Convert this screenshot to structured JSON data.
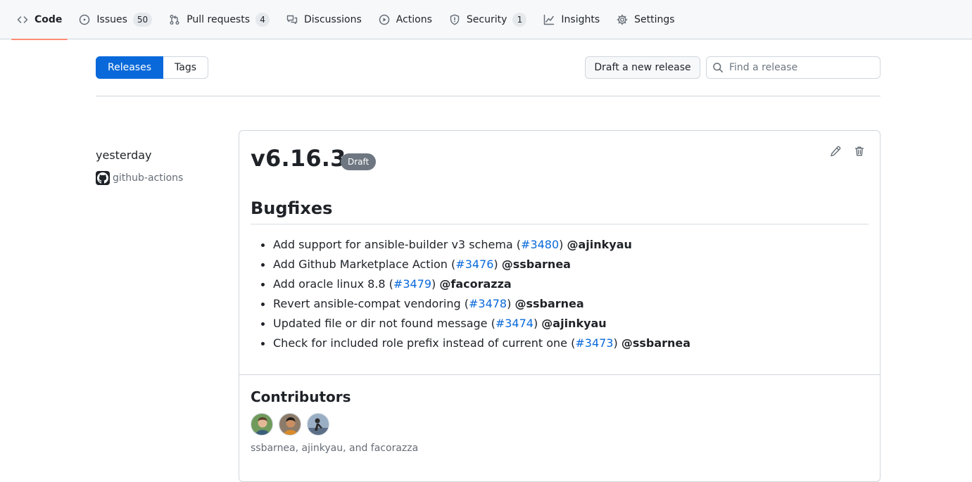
{
  "nav": {
    "items": [
      {
        "label": "Code",
        "icon": "code-icon"
      },
      {
        "label": "Issues",
        "icon": "issue-opened-icon",
        "count": "50"
      },
      {
        "label": "Pull requests",
        "icon": "git-pull-request-icon",
        "count": "4"
      },
      {
        "label": "Discussions",
        "icon": "comment-discussion-icon"
      },
      {
        "label": "Actions",
        "icon": "play-icon"
      },
      {
        "label": "Security",
        "icon": "shield-icon",
        "count": "1"
      },
      {
        "label": "Insights",
        "icon": "graph-icon"
      },
      {
        "label": "Settings",
        "icon": "gear-icon"
      }
    ],
    "selected": "Code",
    "accent": "#fd8c73"
  },
  "subnav": {
    "releases_label": "Releases",
    "tags_label": "Tags",
    "draft_label": "Draft a new release",
    "search_placeholder": "Find a release"
  },
  "release": {
    "date": "yesterday",
    "author": "github-actions",
    "title": "v6.16.3",
    "status": "Draft",
    "section_heading": "Bugfixes",
    "items": [
      {
        "text": "Add support for ansible-builder v3 schema (",
        "pr": "#3480",
        "close": ") ",
        "user": "@ajinkyau"
      },
      {
        "text": "Add Github Marketplace Action (",
        "pr": "#3476",
        "close": ") ",
        "user": "@ssbarnea"
      },
      {
        "text": "Add oracle linux 8.8 (",
        "pr": "#3479",
        "close": ") ",
        "user": "@facorazza"
      },
      {
        "text": "Revert ansible-compat vendoring (",
        "pr": "#3478",
        "close": ") ",
        "user": "@ssbarnea"
      },
      {
        "text": "Updated file or dir not found message (",
        "pr": "#3474",
        "close": ") ",
        "user": "@ajinkyau"
      },
      {
        "text": "Check for included role prefix instead of current one (",
        "pr": "#3473",
        "close": ") ",
        "user": "@ssbarnea"
      }
    ],
    "contributors_heading": "Contributors",
    "contributors_text": "ssbarnea, ajinkyau, and facorazza",
    "contributors": [
      "ssbarnea",
      "ajinkyau",
      "facorazza"
    ]
  },
  "colors": {
    "primary": "#0969da",
    "draft_badge": "#6e7781"
  }
}
